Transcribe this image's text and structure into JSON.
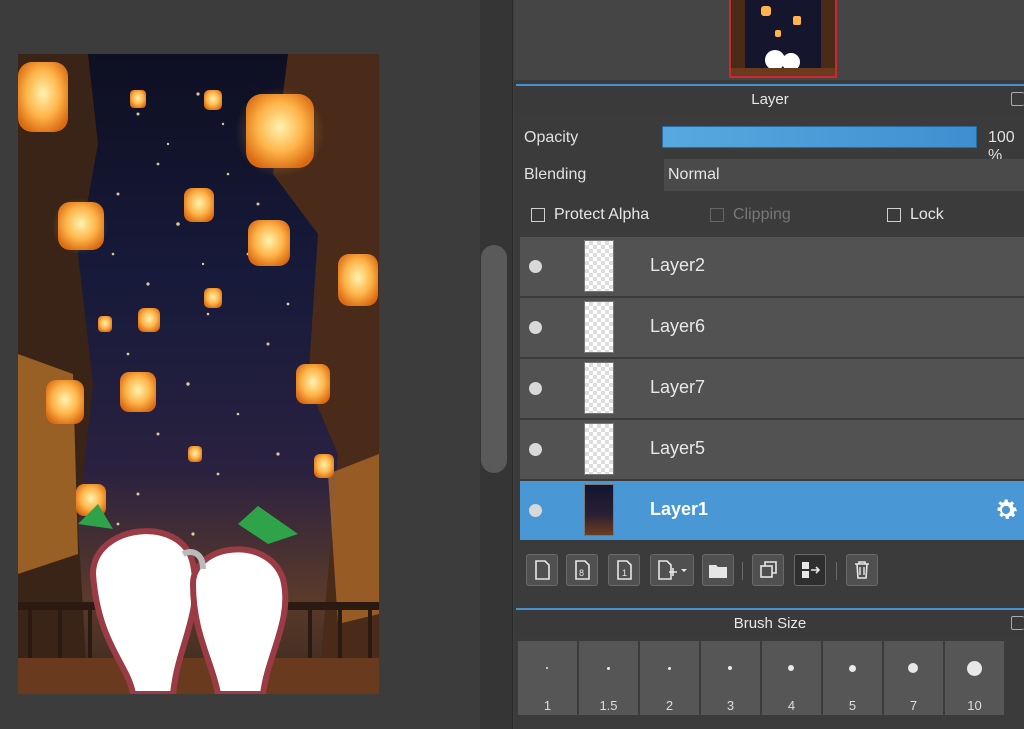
{
  "layer_panel": {
    "title": "Layer",
    "opacity_label": "Opacity",
    "opacity_value": "100 %",
    "opacity_fraction": 1.0,
    "blending_label": "Blending",
    "blending_value": "Normal",
    "protect_alpha_label": "Protect Alpha",
    "clipping_label": "Clipping",
    "lock_label": "Lock",
    "layers": [
      {
        "name": "Layer2",
        "selected": false
      },
      {
        "name": "Layer6",
        "selected": false
      },
      {
        "name": "Layer7",
        "selected": false
      },
      {
        "name": "Layer5",
        "selected": false
      },
      {
        "name": "Layer1",
        "selected": true
      }
    ]
  },
  "brush_panel": {
    "title": "Brush Size",
    "sizes": [
      "1",
      "1.5",
      "2",
      "3",
      "4",
      "5",
      "7",
      "10"
    ]
  },
  "colors": {
    "accent": "#4a97d6",
    "navigator_border": "#d0262c",
    "panel_bg": "#3b3b3b"
  },
  "icons": {
    "new-layer": "new-layer-icon",
    "new-8bit-layer": "new-8bit-layer-icon",
    "new-1bit-layer": "new-1bit-layer-icon",
    "add-layer-menu": "add-layer-menu-icon",
    "folder": "folder-icon",
    "duplicate": "duplicate-layer-icon",
    "merge": "merge-layer-icon",
    "delete": "trash-icon",
    "settings": "gear-icon"
  }
}
